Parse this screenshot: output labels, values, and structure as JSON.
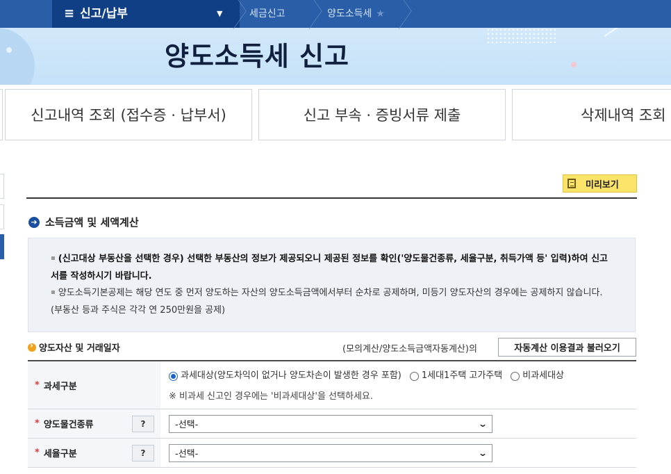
{
  "nav": {
    "menu_icon": "menu-icon",
    "menu_label": "신고/납부",
    "caret": "▼",
    "crumb_1": "세금신고",
    "crumb_2": "양도소득세",
    "star": "★"
  },
  "page_title": "양도소득세 신고",
  "tabs": [
    {
      "label": "신고내역 조회 (접수증 · 납부서)"
    },
    {
      "label": "신고 부속 · 증빙서류 제출"
    },
    {
      "label": "삭제내역 조회"
    }
  ],
  "preview_button": "미리보기",
  "section_title": "소득금액 및 세액계산",
  "notice": {
    "line1_bold": "(신고대상 부동산을 선택한 경우) 선택한 부동산의 정보가 제공되오니 제공된 정보를 확인('양도물건종류, 세율구분, 취득가액 등' 입력)하여 신고서를 작성하시기 바랍니다.",
    "line2": "양도소득기본공제는 해당 연도 중 먼저 양도하는 자산의 양도소득금액에서부터 순차로 공제하며, 미등기 양도자산의 경우에는 공제하지 않습니다. (부동산 등과 주식은 각각 연 250만원을 공제)"
  },
  "sub_section_title": "양도자산 및 거래일자",
  "auto_calc_label": "(모의계산/양도소득금액자동계산)의",
  "auto_calc_button": "자동계산 이용결과 불러오기",
  "form": {
    "tax_class": {
      "label": "과세구분",
      "options": [
        {
          "label": "과세대상(양도차익이 없거나 양도차손이 발생한 경우 포함)",
          "selected": true
        },
        {
          "label": "1세대1주택 고가주택",
          "selected": false
        },
        {
          "label": "비과세대상",
          "selected": false
        }
      ],
      "hint": "※ 비과세 신고인 경우에는 '비과세대상'을 선택하세요."
    },
    "asset_type": {
      "label": "양도물건종류",
      "help": "?",
      "value": "-선택-"
    },
    "rate_class": {
      "label": "세율구분",
      "help": "?",
      "value": "-선택-"
    }
  }
}
